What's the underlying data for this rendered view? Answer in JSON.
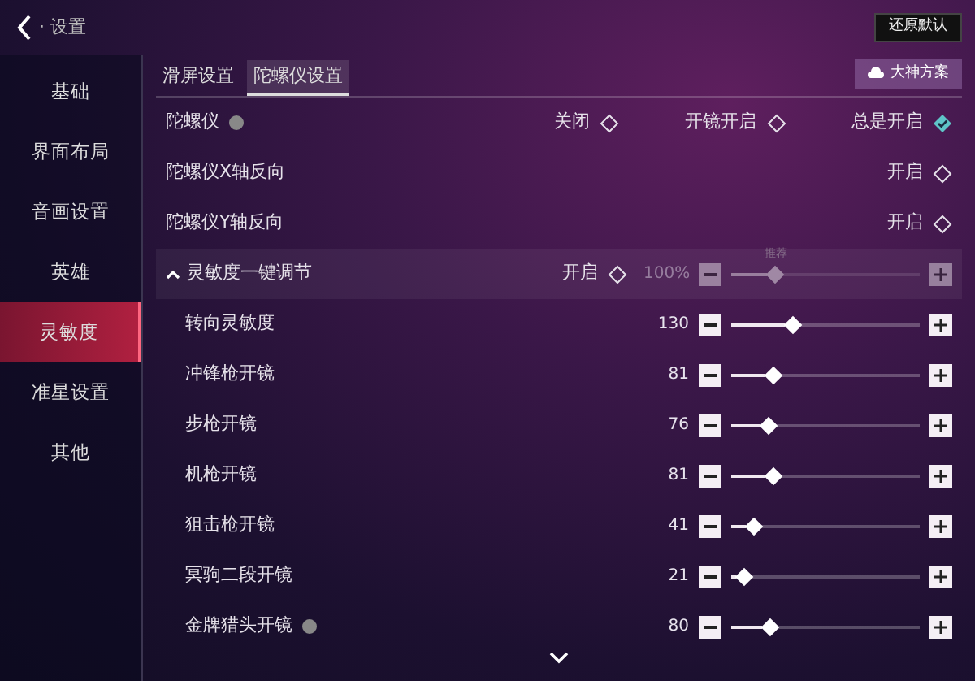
{
  "header": {
    "title": "· 设置",
    "reset_button": "还原默认"
  },
  "sidebar": {
    "items": [
      {
        "label": "基础",
        "selected": false
      },
      {
        "label": "界面布局",
        "selected": false
      },
      {
        "label": "音画设置",
        "selected": false
      },
      {
        "label": "英雄",
        "selected": false
      },
      {
        "label": "灵敏度",
        "selected": true
      },
      {
        "label": "准星设置",
        "selected": false
      },
      {
        "label": "其他",
        "selected": false
      }
    ]
  },
  "tabs": [
    {
      "label": "滑屏设置",
      "selected": false
    },
    {
      "label": "陀螺仪设置",
      "selected": true
    }
  ],
  "plan_button": "大神方案",
  "rows": [
    {
      "kind": "choice",
      "label": "陀螺仪",
      "info": true,
      "options": [
        {
          "label": "关闭",
          "selected": false
        },
        {
          "label": "开镜开启",
          "selected": false
        },
        {
          "label": "总是开启",
          "selected": true
        }
      ]
    },
    {
      "kind": "toggle",
      "label": "陀螺仪X轴反向",
      "info": false,
      "option": "开启",
      "checked": false
    },
    {
      "kind": "toggle",
      "label": "陀螺仪Y轴反向",
      "info": false,
      "option": "开启",
      "checked": false
    },
    {
      "kind": "group",
      "label": "灵敏度一键调节",
      "expanded": true,
      "option": "开启",
      "checked": false,
      "reading": "100%",
      "level": 0.23,
      "marker": "推荐",
      "disabled": true
    },
    {
      "kind": "slider",
      "label": "转向灵敏度",
      "info": false,
      "reading": "130",
      "level": 0.33
    },
    {
      "kind": "slider",
      "label": "冲锋枪开镜",
      "info": false,
      "reading": "81",
      "level": 0.22
    },
    {
      "kind": "slider",
      "label": "步枪开镜",
      "info": false,
      "reading": "76",
      "level": 0.2
    },
    {
      "kind": "slider",
      "label": "机枪开镜",
      "info": false,
      "reading": "81",
      "level": 0.22
    },
    {
      "kind": "slider",
      "label": "狙击枪开镜",
      "info": false,
      "reading": "41",
      "level": 0.12
    },
    {
      "kind": "slider",
      "label": "冥驹二段开镜",
      "info": false,
      "reading": "21",
      "level": 0.07
    },
    {
      "kind": "slider",
      "label": "金牌猎头开镜",
      "info": true,
      "reading": "80",
      "level": 0.21
    }
  ]
}
